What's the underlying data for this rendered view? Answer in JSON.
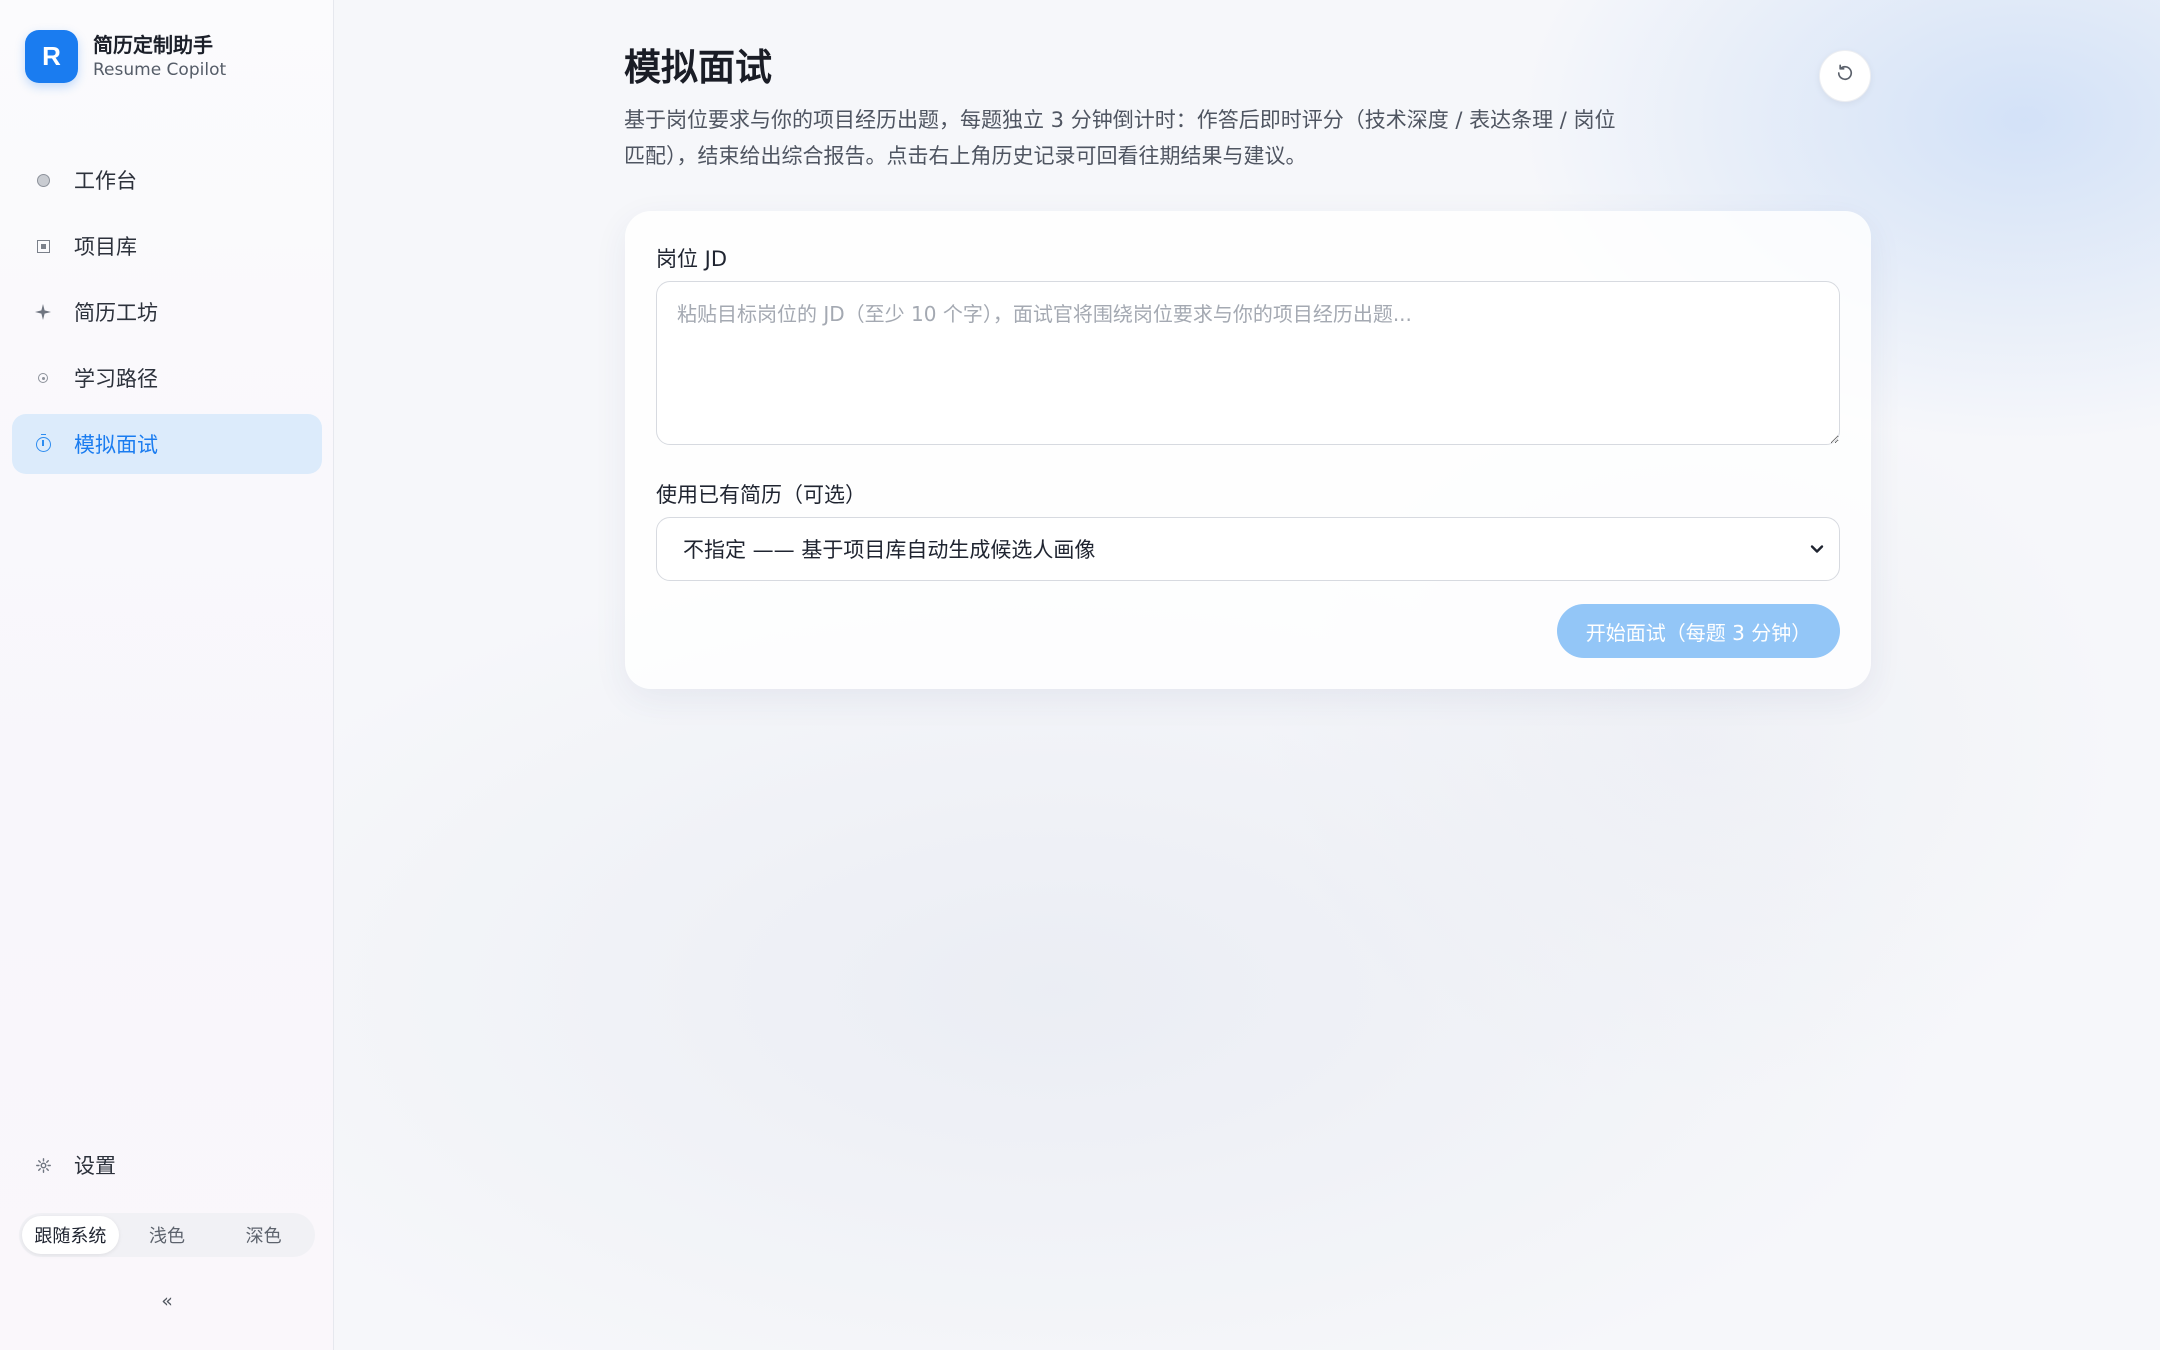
{
  "brand": {
    "logo_letter": "R",
    "title": "简历定制助手",
    "subtitle": "Resume Copilot"
  },
  "sidebar": {
    "items": [
      {
        "label": "工作台",
        "icon": "circle-dot-icon",
        "active": false
      },
      {
        "label": "项目库",
        "icon": "square-icon",
        "active": false
      },
      {
        "label": "简历工坊",
        "icon": "sparkle-icon",
        "active": false
      },
      {
        "label": "学习路径",
        "icon": "ring-icon",
        "active": false
      },
      {
        "label": "模拟面试",
        "icon": "timer-icon",
        "active": true
      }
    ],
    "settings_label": "设置",
    "settings_icon": "gear-icon",
    "theme_options": [
      "跟随系统",
      "浅色",
      "深色"
    ],
    "theme_selected": "跟随系统",
    "collapse_label": "«"
  },
  "page": {
    "title": "模拟面试",
    "description": "基于岗位要求与你的项目经历出题，每题独立 3 分钟倒计时：作答后即时评分（技术深度 / 表达条理 / 岗位匹配），结束给出综合报告。点击右上角历史记录可回看往期结果与建议。",
    "history_icon": "history-icon"
  },
  "form": {
    "jd_label": "岗位 JD",
    "jd_value": "",
    "jd_placeholder": "粘贴目标岗位的 JD（至少 10 个字），面试官将围绕岗位要求与你的项目经历出题...",
    "resume_label": "使用已有简历（可选）",
    "resume_selected": "不指定 —— 基于项目库自动生成候选人画像",
    "start_button": "开始面试（每题 3 分钟）"
  },
  "colors": {
    "accent": "#1a7cf0",
    "active_nav_bg": "#dcebfb",
    "start_button_disabled": "#93c6f7"
  }
}
